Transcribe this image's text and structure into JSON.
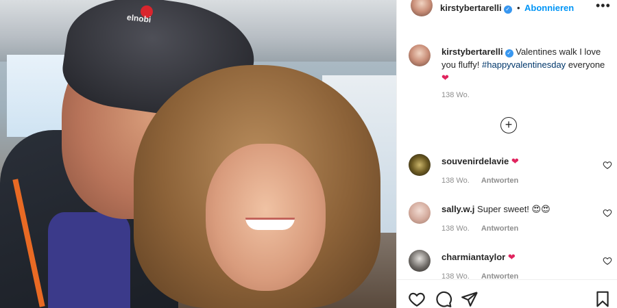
{
  "post": {
    "username": "kirstybertarelli",
    "follow_label": "Abonnieren",
    "separator": "•",
    "more": "•••"
  },
  "caption": {
    "username": "kirstybertarelli",
    "text": "Valentines walk I love you fluffy!",
    "hashtag": "#happyvalentinesday",
    "suffix": "everyone",
    "time": "138 Wo."
  },
  "photo": {
    "cap_brand": "elnobi"
  },
  "load_more": "+",
  "comments": [
    {
      "username": "souvenirdelavie",
      "text": "",
      "emoji": "❤",
      "time": "138 Wo.",
      "reply": "Antworten"
    },
    {
      "username": "sally.w.j",
      "text": "Super sweet!",
      "emoji": "😍😍",
      "time": "138 Wo.",
      "reply": "Antworten"
    },
    {
      "username": "charmiantaylor",
      "text": "",
      "emoji": "❤",
      "time": "138 Wo.",
      "reply": "Antworten"
    }
  ],
  "icons": {
    "like": "heart-icon",
    "comment": "comment-icon",
    "share": "share-icon",
    "save": "bookmark-icon",
    "verified": "verified-badge-icon"
  },
  "colors": {
    "accent": "#0095f6",
    "heart": "#e0245e",
    "verified": "#3897f0",
    "meta": "#8e8e8e"
  }
}
